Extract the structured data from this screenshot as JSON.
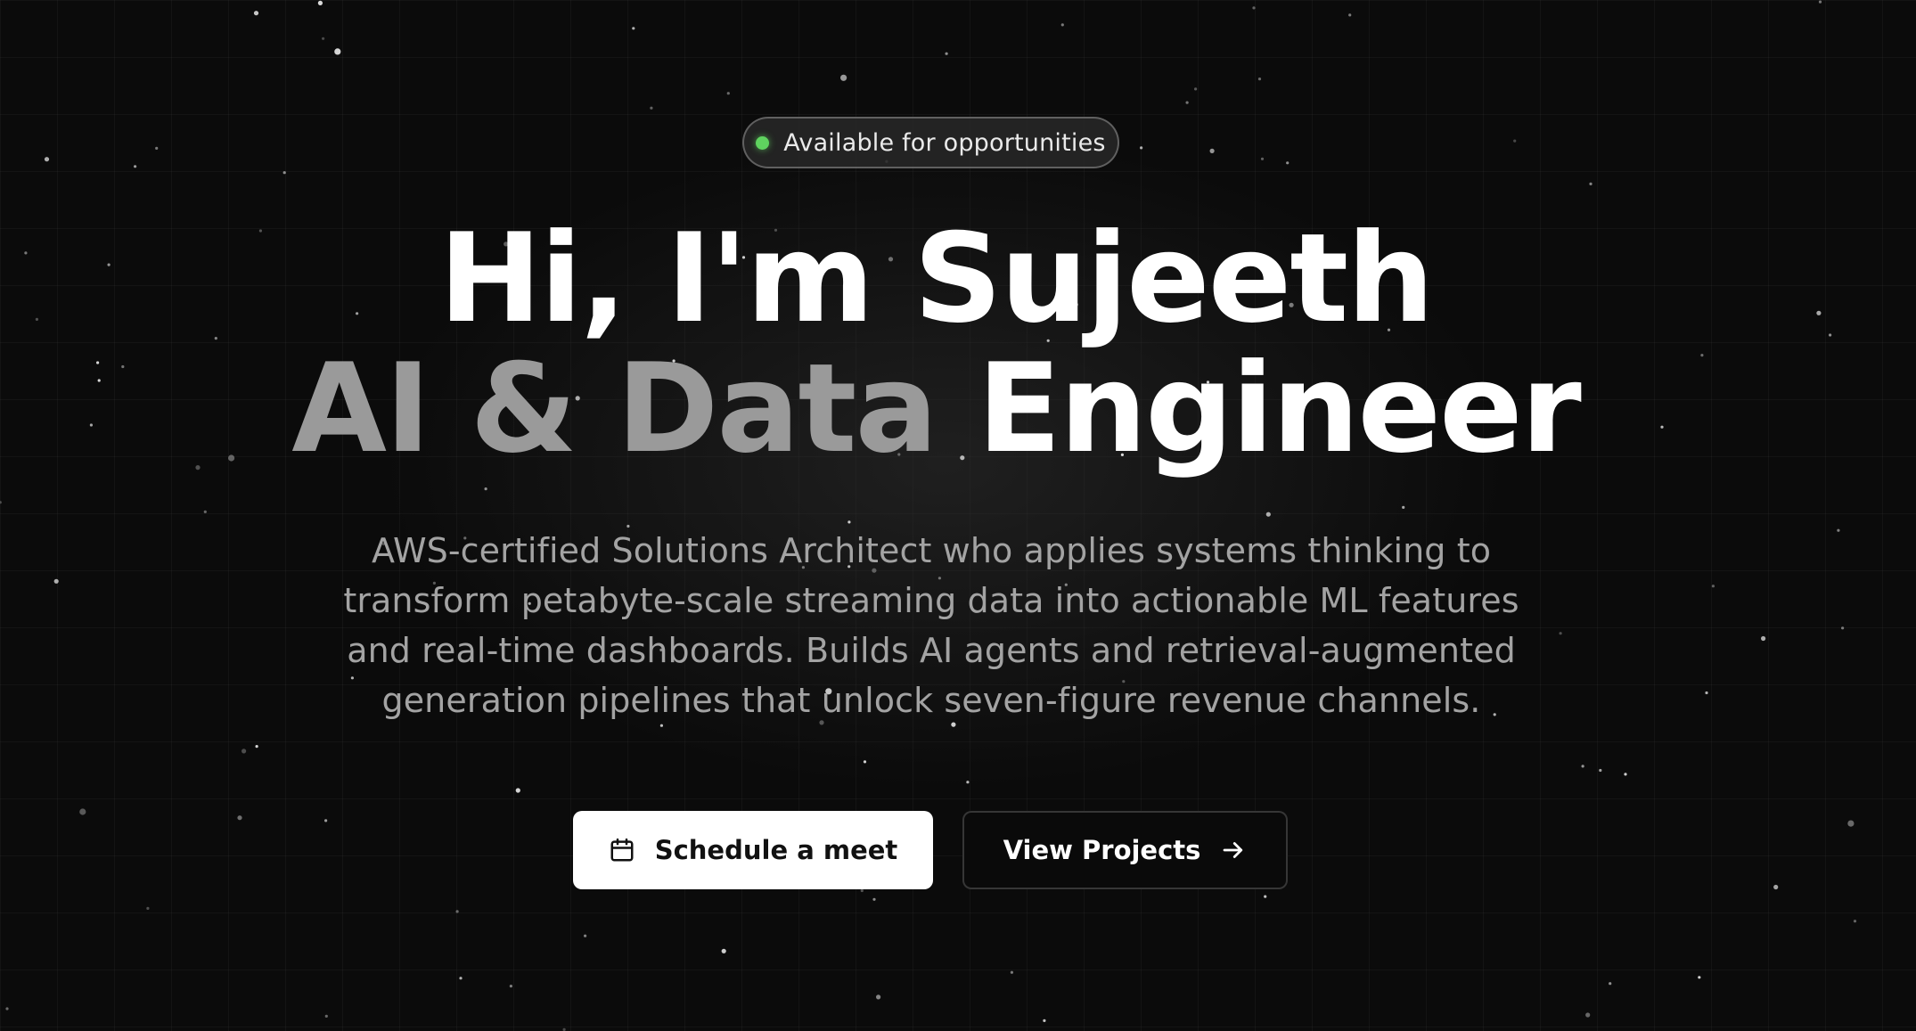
{
  "badge": {
    "label": "Available for opportunities",
    "status_color": "#5fd35f"
  },
  "headline": {
    "greeting": "Hi, I'm Sujeeth",
    "role_muted": "AI & Data",
    "role_bright": "Engineer"
  },
  "description": "AWS-certified Solutions Architect who applies systems thinking to transform petabyte-scale streaming data into actionable ML features and real-time dashboards. Builds AI agents and retrieval-augmented generation pipelines that unlock seven-figure revenue channels.",
  "buttons": {
    "primary": {
      "label": "Schedule a meet",
      "icon": "calendar-icon"
    },
    "secondary": {
      "label": "View Projects",
      "icon": "arrow-right-icon"
    }
  },
  "colors": {
    "background": "#0b0b0b",
    "text_bright": "#ffffff",
    "text_muted": "#9a9a9a",
    "body_text": "#a3a3a3"
  }
}
